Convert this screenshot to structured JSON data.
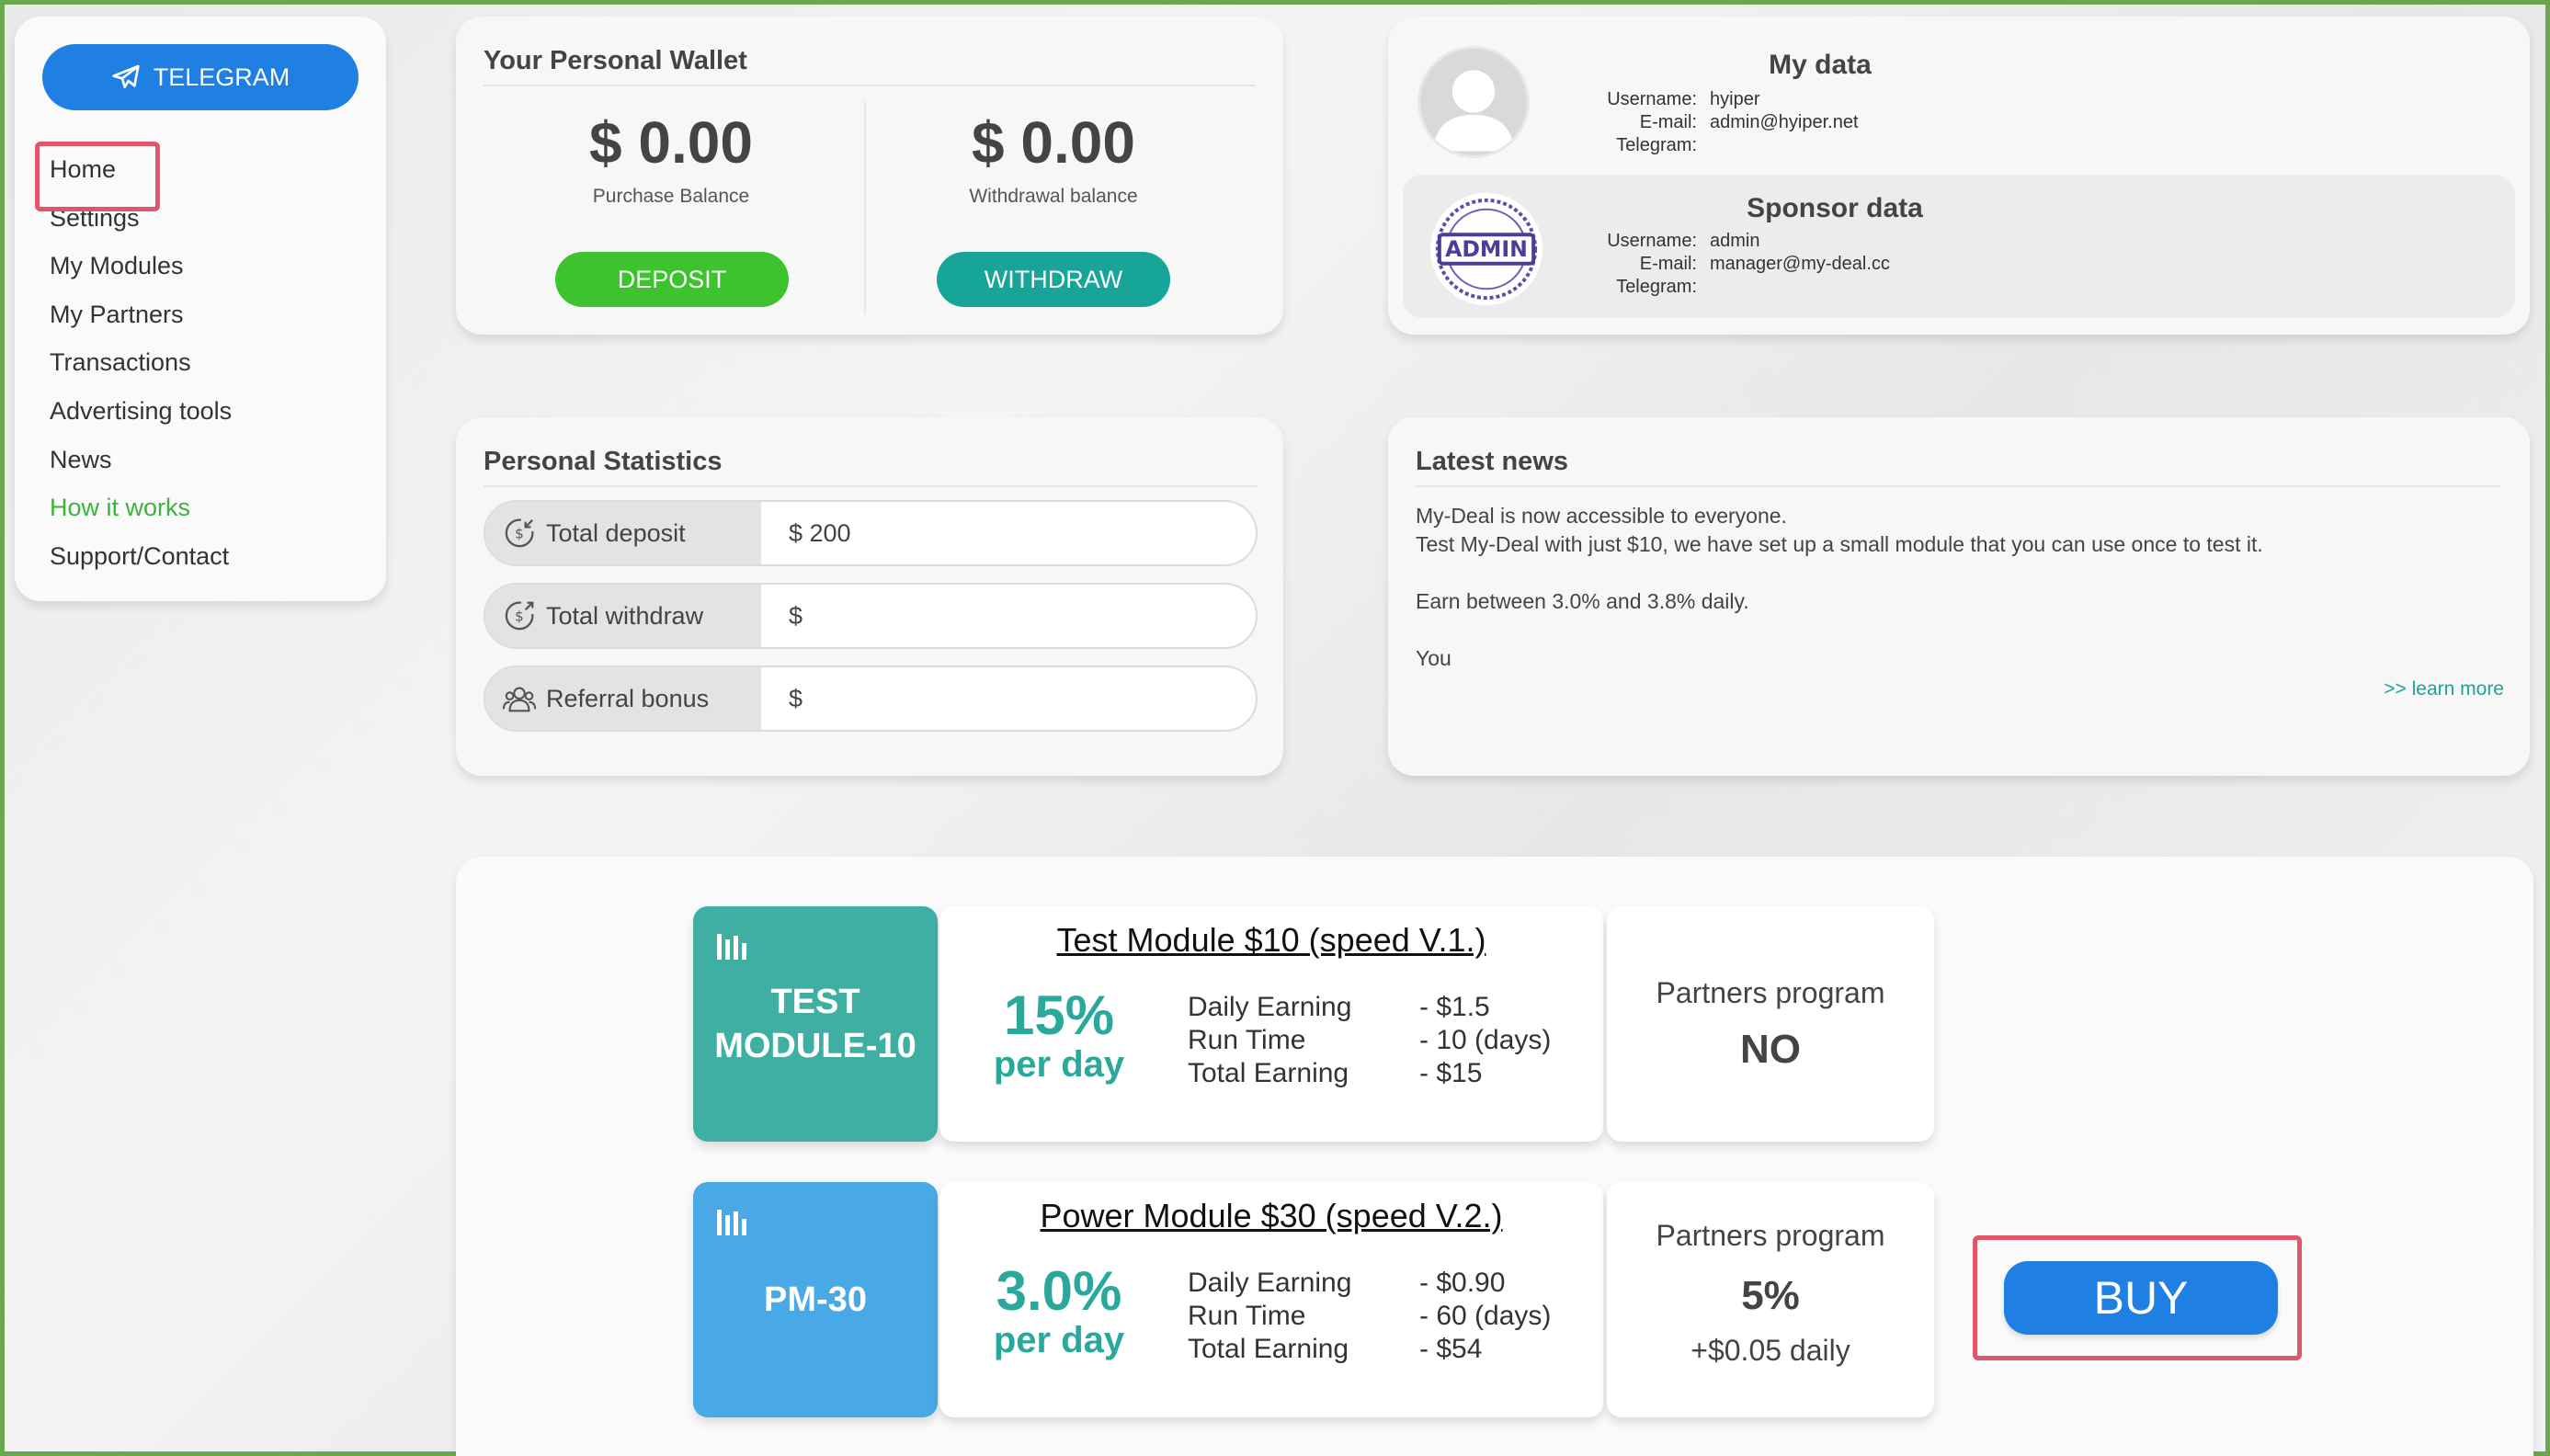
{
  "sidebar": {
    "telegram_label": "TELEGRAM",
    "items": [
      {
        "label": "Home"
      },
      {
        "label": "Settings"
      },
      {
        "label": "My Modules"
      },
      {
        "label": "My Partners"
      },
      {
        "label": "Transactions"
      },
      {
        "label": "Advertising tools"
      },
      {
        "label": "News"
      },
      {
        "label": "How it works",
        "color": "#3cb43c"
      },
      {
        "label": "Support/Contact"
      }
    ]
  },
  "wallet": {
    "title": "Your Personal Wallet",
    "purchase": {
      "amount": "$ 0.00",
      "label": "Purchase Balance",
      "button": "DEPOSIT",
      "button_color": "#3cc32d"
    },
    "withdrawal": {
      "amount": "$ 0.00",
      "label": "Withdrawal balance",
      "button": "WITHDRAW",
      "button_color": "#17a59a"
    }
  },
  "my_data": {
    "title": "My data",
    "username_key": "Username:",
    "username": "hyiper",
    "email_key": "E-mail:",
    "email": "admin@hyiper.net",
    "telegram_key": "Telegram:",
    "telegram": ""
  },
  "sponsor_data": {
    "title": "Sponsor data",
    "badge": "ADMIN",
    "username_key": "Username:",
    "username": "admin",
    "email_key": "E-mail:",
    "email": "manager@my-deal.cc",
    "telegram_key": "Telegram:",
    "telegram": ""
  },
  "stats": {
    "title": "Personal Statistics",
    "rows": [
      {
        "label": "Total deposit",
        "value": "$ 200",
        "icon": "dollar-in-icon"
      },
      {
        "label": "Total withdraw",
        "value": "$",
        "icon": "dollar-out-icon"
      },
      {
        "label": "Referral bonus",
        "value": "$",
        "icon": "users-icon"
      }
    ]
  },
  "news": {
    "title": "Latest news",
    "line1": "My-Deal is now accessible to everyone.",
    "line2": "Test My-Deal with just $10, we have set up a small module that you can use once to test it.",
    "line3": "Earn between 3.0% and 3.8% daily.",
    "line4": "You",
    "learn_more": ">> learn more"
  },
  "modules": [
    {
      "tag": "TEST MODULE-10",
      "tag_color": "#3fafa3",
      "name": "Test Module $10 (speed V.1.)",
      "percent": "15%",
      "per_day": "per day",
      "daily_key": "Daily Earning",
      "daily": "- $1.5",
      "run_key": "Run Time",
      "run": "- 10 (days)",
      "total_key": "Total Earning",
      "total": "- $15",
      "partners_title": "Partners program",
      "partners_value": "NO",
      "partners_sub": ""
    },
    {
      "tag": "PM-30",
      "tag_color": "#49a8e6",
      "name": "Power Module $30 (speed V.2.)",
      "percent": "3.0%",
      "per_day": "per day",
      "daily_key": "Daily Earning",
      "daily": "- $0.90",
      "run_key": "Run Time",
      "run": "- 60 (days)",
      "total_key": "Total Earning",
      "total": "- $54",
      "partners_title": "Partners program",
      "partners_value": "5%",
      "partners_sub": "+$0.05 daily"
    }
  ],
  "buy_label": "BUY",
  "colors": {
    "primary_blue": "#1f7fe3",
    "highlight_red": "#e0556a",
    "teal": "#2aa89b",
    "green": "#3cb43c"
  }
}
